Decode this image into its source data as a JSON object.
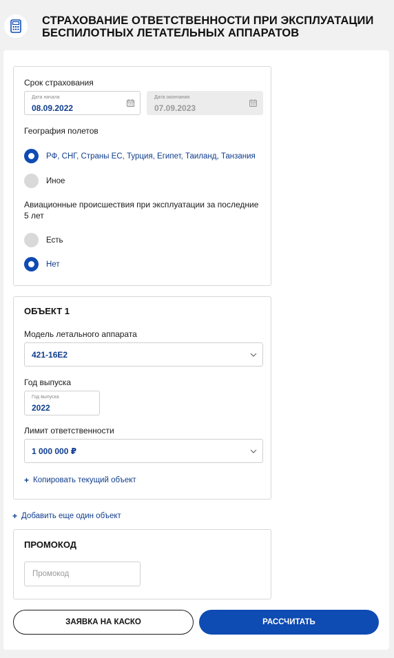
{
  "header": {
    "title": "СТРАХОВАНИЕ ОТВЕТСТВЕННОСТИ ПРИ ЭКСПЛУАТАЦИИ БЕСПИЛОТНЫХ ЛЕТАТЕЛЬНЫХ АППАРАТОВ",
    "icon": "calculator-icon"
  },
  "insurance": {
    "period_label": "Срок страхования",
    "start": {
      "label": "Дата начала",
      "value": "08.09.2022"
    },
    "end": {
      "label": "Дата окончания",
      "value": "07.09.2023"
    },
    "geography_label": "География полетов",
    "geography_options": [
      {
        "label": "РФ, СНГ, Страны ЕС, Турция, Египет, Таиланд, Танзания",
        "selected": true
      },
      {
        "label": "Иное",
        "selected": false
      }
    ],
    "incidents_label": "Авиационные происшествия при эксплуатации за последние 5 лет",
    "incidents_options": [
      {
        "label": "Есть",
        "selected": false
      },
      {
        "label": "Нет",
        "selected": true
      }
    ]
  },
  "object": {
    "title": "ОБЪЕКТ 1",
    "model_label": "Модель летального аппарата",
    "model_value": "421-16Е2",
    "year_label": "Год выпуска",
    "year_small_label": "Год выпуска",
    "year_value": "2022",
    "limit_label": "Лимит ответственности",
    "limit_value": "1 000 000 ₽",
    "copy_link": "Копировать текущий объект"
  },
  "add_object_link": "Добавить еще один объект",
  "promo": {
    "title": "ПРОМОКОД",
    "placeholder": "Промокод"
  },
  "buttons": {
    "kasko": "ЗАЯВКА НА КАСКО",
    "calculate": "РАССЧИТАТЬ"
  },
  "colors": {
    "accent": "#0e4bb3",
    "value_text": "#0f3c8c",
    "background": "#f1f1f1"
  }
}
